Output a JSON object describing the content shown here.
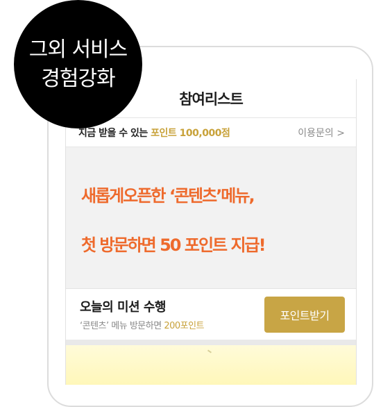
{
  "badge": {
    "line1": "그외 서비스",
    "line2": "경험강화"
  },
  "header": {
    "title": "참여리스트"
  },
  "info_bar": {
    "prefix": "지금 받을 수 있는",
    "highlight": "포인트 100,000점",
    "help_link": "이용문의 >"
  },
  "banner": {
    "line1": "새롭게오픈한 ‘콘텐츠’메뉴,",
    "line2": "첫 방문하면 50 포인트 지급!"
  },
  "mission": {
    "title": "오늘의 미션 수행",
    "desc_prefix": "‘콘텐츠’ 메뉴 방문하면",
    "desc_points": "200포인트",
    "button_label": "포인트받기"
  },
  "colors": {
    "accent_orange": "#ee6a2c",
    "accent_gold": "#c8a545",
    "badge_bg": "#000000"
  }
}
